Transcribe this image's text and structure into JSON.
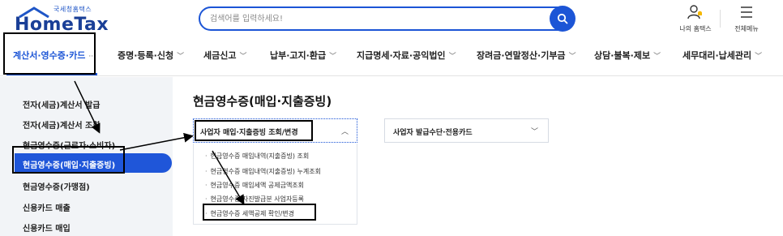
{
  "header": {
    "logo_sub": "국세청홈택스",
    "logo_main": "HomeTax",
    "search_placeholder": "검색어를 입력하세요!",
    "my_hometax_label": "나의 홈택스",
    "all_menu_label": "전체메뉴"
  },
  "gnb": {
    "items": [
      {
        "label": "계산서·영수증·카드"
      },
      {
        "label": "증명·등록·신청"
      },
      {
        "label": "세금신고"
      },
      {
        "label": "납부·고지·환급"
      },
      {
        "label": "지급명세·자료·공익법인"
      },
      {
        "label": "장려금·연말정산·기부금"
      },
      {
        "label": "상담·불복·제보"
      },
      {
        "label": "세무대리·납세관리"
      }
    ]
  },
  "sidebar": {
    "items": [
      {
        "label": "전자(세금)계산서 발급"
      },
      {
        "label": "전자(세금)계산서 조회"
      },
      {
        "label": "현금영수증(근로자·소비자)"
      },
      {
        "label": "현금영수증(매입·지출증빙)"
      },
      {
        "label": "현금영수증(가맹점)"
      },
      {
        "label": "신용카드 매출"
      },
      {
        "label": "신용카드 매입"
      }
    ]
  },
  "main": {
    "title": "현금영수증(매입·지출증빙)",
    "accordion1": {
      "label": "사업자 매입·지출증빙 조회/변경",
      "items": [
        {
          "label": "현금영수증 매입내역(지출증빙) 조회"
        },
        {
          "label": "현금영수증 매입내역(지출증빙) 누계조회"
        },
        {
          "label": "현금영수증 매입세액 공제금액조회"
        },
        {
          "label": "현금영수증 자진발급분 사업자등록"
        },
        {
          "label": "현금영수증 세액공제 확인/변경"
        }
      ]
    },
    "accordion2": {
      "label": "사업자 발급수단·전용카드"
    }
  },
  "colors": {
    "brand_blue": "#1c55d6",
    "active_bg": "#1f56d9",
    "sidebar_bg": "#f2f4f7"
  },
  "icons": {
    "search": "search-icon",
    "user": "user-bell-icon",
    "menu": "hamburger-menu-icon",
    "chevron_down": "chevron-down-icon",
    "chevron_up": "chevron-up-icon"
  }
}
